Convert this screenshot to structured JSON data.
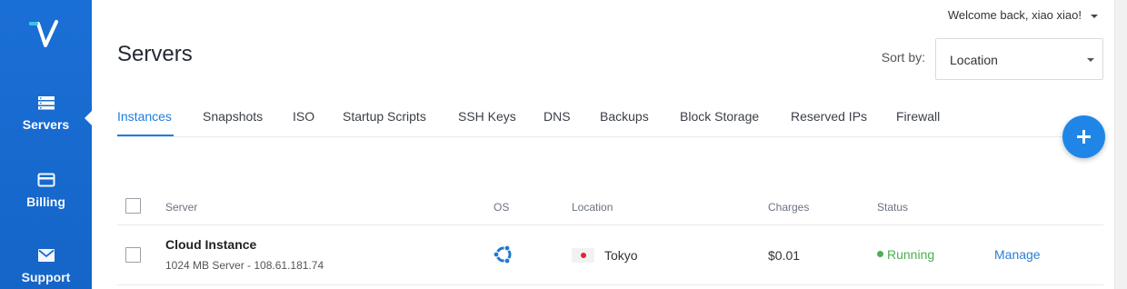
{
  "sidebar": {
    "items": [
      {
        "label": "Servers",
        "icon": "servers-icon",
        "active": true
      },
      {
        "label": "Billing",
        "icon": "credit-card-icon"
      },
      {
        "label": "Support",
        "icon": "envelope-icon"
      }
    ],
    "color": "#1a6fd6"
  },
  "header": {
    "welcome": "Welcome back, xiao xiao!",
    "title": "Servers",
    "sort_label": "Sort by:",
    "sort_value": "Location"
  },
  "tabs": [
    "Instances",
    "Snapshots",
    "ISO",
    "Startup Scripts",
    "SSH Keys",
    "DNS",
    "Backups",
    "Block Storage",
    "Reserved IPs",
    "Firewall"
  ],
  "table": {
    "columns": [
      "Server",
      "OS",
      "Location",
      "Charges",
      "Status"
    ],
    "rows": [
      {
        "name": "Cloud Instance",
        "desc": "1024 MB Server - 108.61.181.74",
        "os_icon": "ubuntu-icon",
        "location": "Tokyo",
        "charges": "$0.01",
        "status": "Running",
        "action": "Manage"
      }
    ]
  },
  "colors": {
    "accent": "#1c7ee0",
    "running": "#4caf50"
  }
}
